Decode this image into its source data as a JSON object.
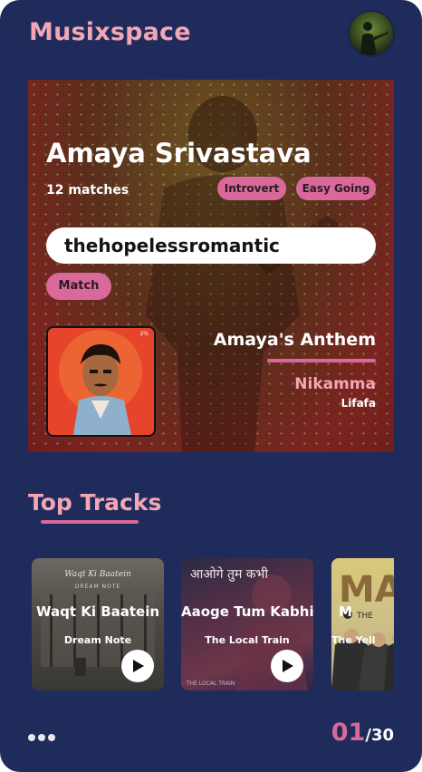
{
  "app": {
    "title": "Musixspace"
  },
  "header": {
    "avatar_icon": "user-avatar-icon"
  },
  "profile": {
    "name": "Amaya Srivastava",
    "matches": "12 matches",
    "tags": [
      "Introvert",
      "Easy Going"
    ],
    "search": {
      "value": "thehopelessromantic"
    },
    "match_button": "Match",
    "anthem": {
      "label": "Amaya's Anthem",
      "song": "Nikamma",
      "artist": "Lifafa",
      "album_corner_text": "2%"
    }
  },
  "top_tracks": {
    "title": "Top Tracks",
    "items": [
      {
        "title": "Waqt Ki Baatein",
        "artist": "Dream Note",
        "cover_text": "Waqt Ki Baatein",
        "cover_subtext": "DREAM NOTE"
      },
      {
        "title": "Aaoge Tum Kabhi",
        "artist": "The Local Train",
        "cover_text": "आओगे तुम कभी",
        "cover_subtext": "THE LOCAL TRAIN"
      },
      {
        "title": "M",
        "artist": "The Yell",
        "cover_text": "MA",
        "cover_subtext": "THE"
      }
    ]
  },
  "pager": {
    "current": "01",
    "total": "/30"
  },
  "colors": {
    "background": "#1f2b5b",
    "accent": "#d8699a",
    "title_pink": "#f3a6b4"
  }
}
